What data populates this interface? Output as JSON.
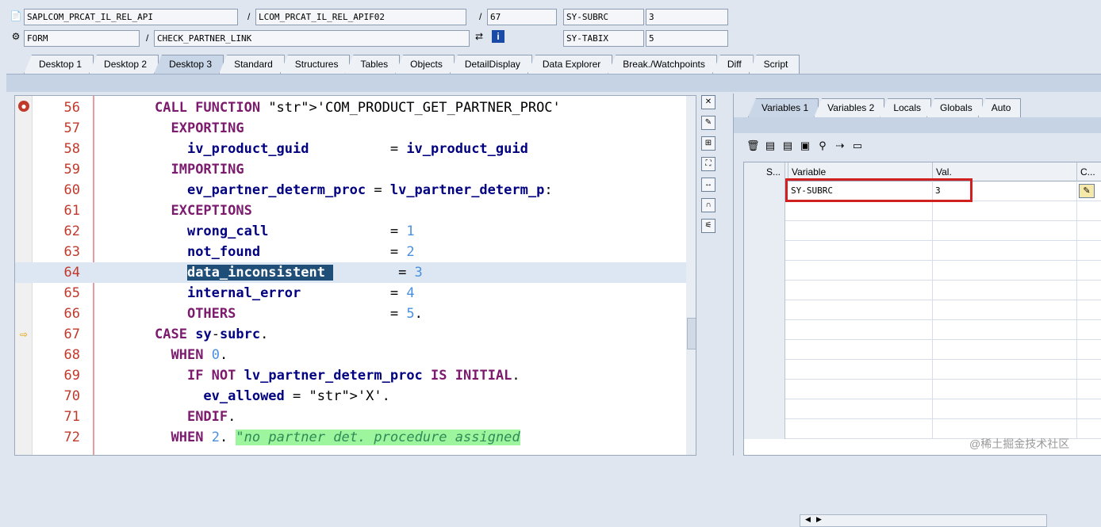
{
  "header": {
    "program": "SAPLCOM_PRCAT_IL_REL_API",
    "include": "LCOM_PRCAT_IL_REL_APIF02",
    "line": "67",
    "var1_name": "SY-SUBRC",
    "var1_val": "3",
    "type": "FORM",
    "form_name": "CHECK_PARTNER_LINK",
    "var2_name": "SY-TABIX",
    "var2_val": "5",
    "slash": "/"
  },
  "tabs": [
    "Desktop 1",
    "Desktop 2",
    "Desktop 3",
    "Standard",
    "Structures",
    "Tables",
    "Objects",
    "DetailDisplay",
    "Data Explorer",
    "Break./Watchpoints",
    "Diff",
    "Script"
  ],
  "code": {
    "lines": [
      {
        "n": "56",
        "t": "CALL FUNCTION 'COM_PRODUCT_GET_PARTNER_PROC'"
      },
      {
        "n": "57",
        "t": "  EXPORTING"
      },
      {
        "n": "58",
        "t": "    iv_product_guid          = iv_product_guid"
      },
      {
        "n": "59",
        "t": "  IMPORTING"
      },
      {
        "n": "60",
        "t": "    ev_partner_determ_proc = lv_partner_determ_p:"
      },
      {
        "n": "61",
        "t": "  EXCEPTIONS"
      },
      {
        "n": "62",
        "t": "    wrong_call               = 1"
      },
      {
        "n": "63",
        "t": "    not_found                = 2"
      },
      {
        "n": "64",
        "t": "    data_inconsistent        = 3"
      },
      {
        "n": "65",
        "t": "    internal_error           = 4"
      },
      {
        "n": "66",
        "t": "    OTHERS                   = 5."
      },
      {
        "n": "67",
        "t": "CASE sy-subrc."
      },
      {
        "n": "68",
        "t": "  WHEN 0."
      },
      {
        "n": "69",
        "t": "    IF NOT lv_partner_determ_proc IS INITIAL."
      },
      {
        "n": "70",
        "t": "      ev_allowed = 'X'."
      },
      {
        "n": "71",
        "t": "    ENDIF."
      },
      {
        "n": "72",
        "t": "  WHEN 2. \"no partner det. procedure assigned"
      }
    ]
  },
  "right": {
    "tabs": [
      "Variables 1",
      "Variables 2",
      "Locals",
      "Globals",
      "Auto"
    ],
    "cols": {
      "s": "S...",
      "var": "Variable",
      "val": "Val.",
      "c": "C..."
    },
    "row": {
      "var": "SY-SUBRC",
      "val": "3"
    }
  },
  "watermark": "@稀土掘金技术社区"
}
